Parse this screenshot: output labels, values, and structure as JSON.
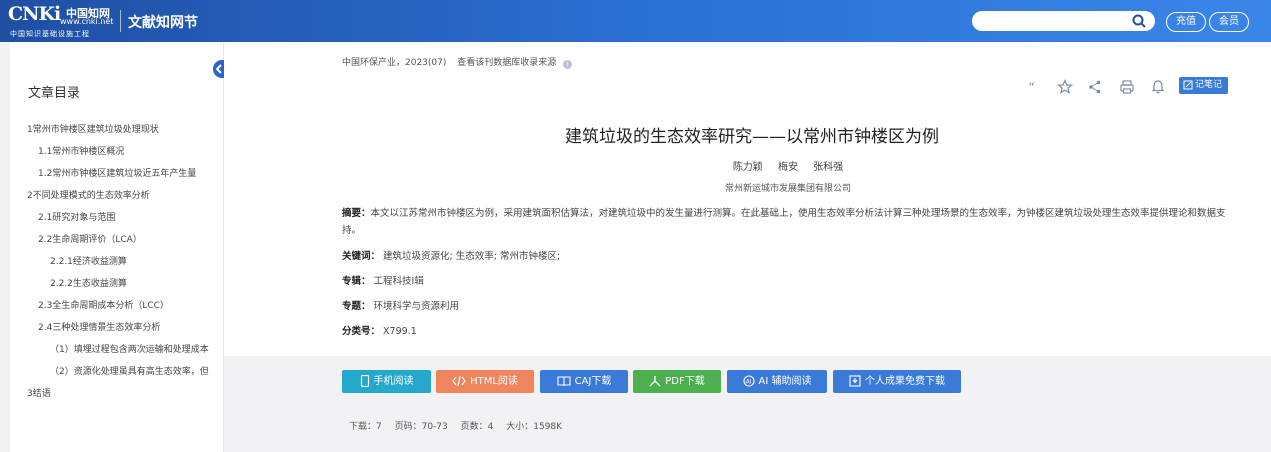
{
  "header": {
    "logo_mark": "CNKi",
    "logo_cn": "中国知网",
    "logo_url": "www.cnki.net",
    "logo_sub": "中国知识基础设施工程",
    "title": "文献知网节",
    "search_placeholder": "",
    "recharge_label": "充值",
    "member_label": "会员"
  },
  "sidebar": {
    "title": "文章目录",
    "items": [
      {
        "level": 1,
        "label": "1常州市钟楼区建筑垃圾处理现状"
      },
      {
        "level": 2,
        "label": "1.1常州市钟楼区概况"
      },
      {
        "level": 2,
        "label": "1.2常州市钟楼区建筑垃圾近五年产生量"
      },
      {
        "level": 1,
        "label": "2不同处理模式的生态效率分析"
      },
      {
        "level": 2,
        "label": "2.1研究对象与范围"
      },
      {
        "level": 2,
        "label": "2.2生命周期评价（LCA）"
      },
      {
        "level": 3,
        "label": "2.2.1经济收益测算"
      },
      {
        "level": 3,
        "label": "2.2.2生态收益测算"
      },
      {
        "level": 2,
        "label": "2.3全生命周期成本分析（LCC）"
      },
      {
        "level": 2,
        "label": "2.4三种处理情景生态效率分析"
      },
      {
        "level": 3,
        "label": "（1）填埋过程包含两次运输和处理成本"
      },
      {
        "level": 3,
        "label": "（2）资源化处理虽具有高生态效率，但"
      },
      {
        "level": 1,
        "label": "3结语"
      }
    ]
  },
  "article": {
    "journal": "中国环保产业，2023(07)",
    "source_link": "查看该刊数据库收录来源",
    "title": "建筑垃圾的生态效率研究——以常州市钟楼区为例",
    "authors": [
      "陈力颖",
      "梅安",
      "张科强"
    ],
    "organization": "常州新运城市发展集团有限公司",
    "abstract_label": "摘要：",
    "abstract": "本文以江苏常州市钟楼区为例，采用建筑面积估算法，对建筑垃圾中的发生量进行测算。在此基础上，使用生态效率分析法计算三种处理场景的生态效率，为钟楼区建筑垃圾处理生态效率提供理论和数据支持。",
    "keywords_label": "关键词：",
    "keywords": "建筑垃圾资源化;  生态效率;  常州市钟楼区;",
    "album_label": "专辑：",
    "album": "工程科技Ⅰ辑",
    "topic_label": "专题：",
    "topic": "环境科学与资源利用",
    "clc_label": "分类号：",
    "clc": "X799.1",
    "note_label": "记笔记"
  },
  "actions": {
    "mobile": "手机阅读",
    "html": "HTML阅读",
    "caj": "CAJ下载",
    "pdf": "PDF下载",
    "ai": "AI 辅助阅读",
    "free": "个人成果免费下载"
  },
  "stats": {
    "downloads": "下载：7",
    "pages_range": "页码：70-73",
    "page_count": "页数：4",
    "size": "大小：1598K"
  },
  "colors": {
    "header_blue": "#2b6fd2",
    "btn_blue": "#3a7bd9",
    "btn_cyan": "#26a8cc",
    "btn_orange": "#f0845d",
    "btn_green": "#4caf50"
  }
}
